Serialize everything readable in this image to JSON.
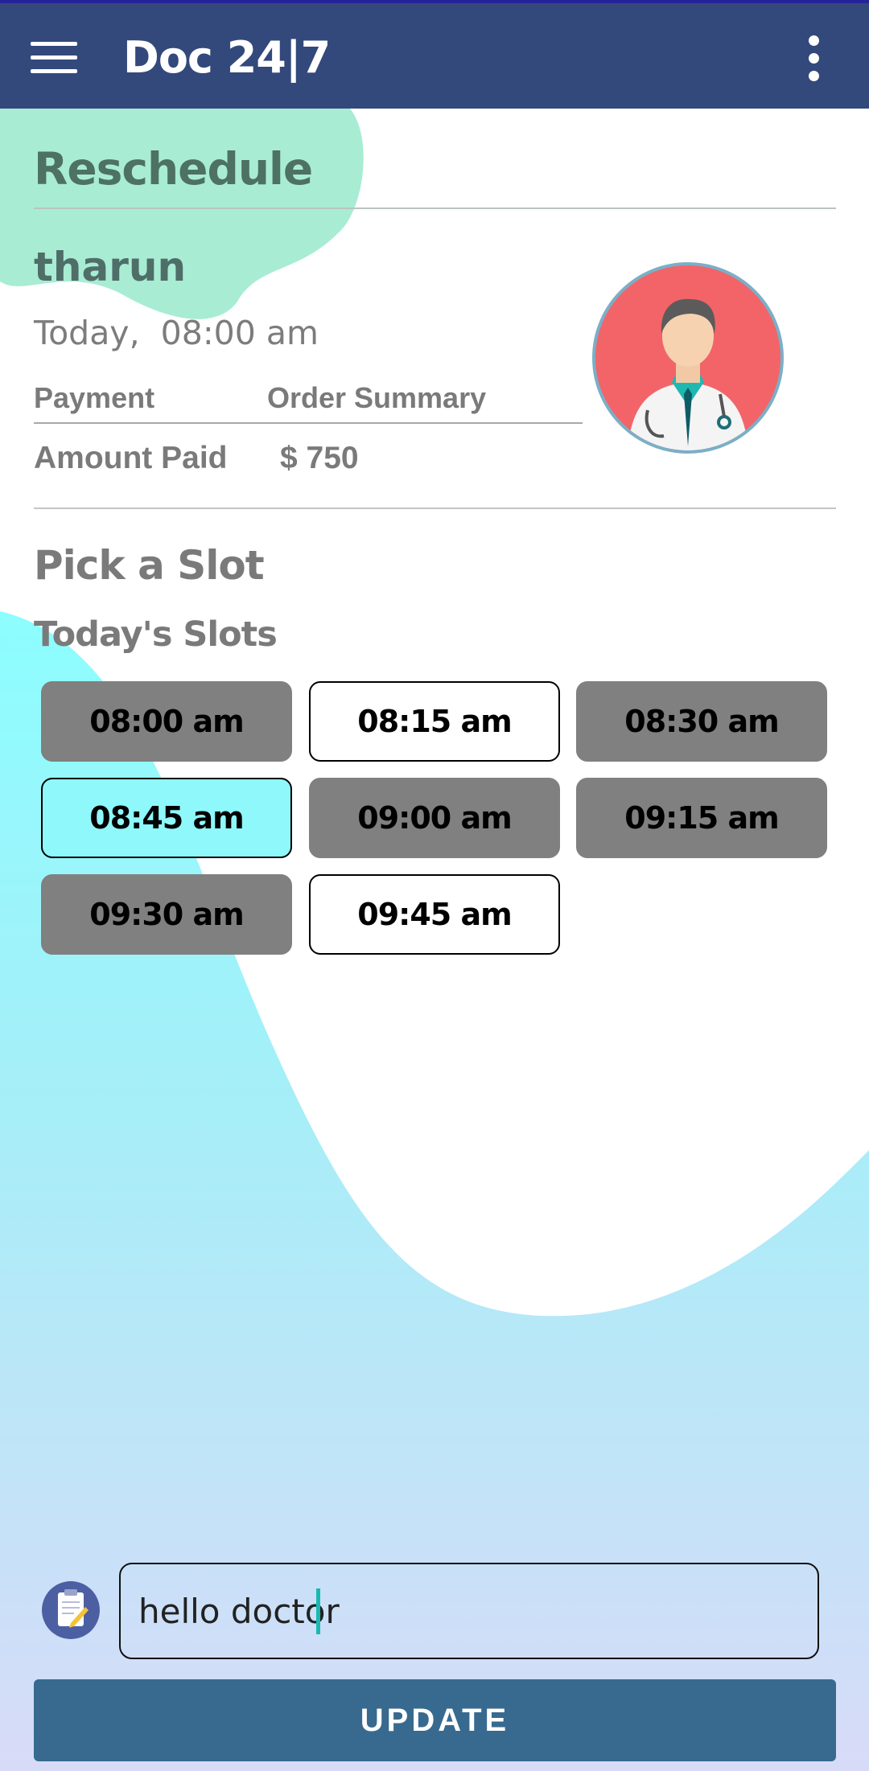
{
  "app_bar": {
    "title": "Doc 24|7",
    "menu_icon": "hamburger-menu-icon",
    "overflow_icon": "more-vert-icon",
    "color": "#33497c"
  },
  "reschedule": {
    "title": "Reschedule",
    "patient_name": "tharun",
    "appointment_time": "Today,  08:00 am",
    "payment_label": "Payment",
    "order_summary_label": "Order Summary",
    "amount_paid_label": "Amount Paid",
    "amount_paid_value": "$ 750",
    "avatar_icon": "doctor-avatar-icon"
  },
  "slots": {
    "title": "Pick a Slot",
    "subtitle": "Today's Slots",
    "items": [
      {
        "label": "08:00 am",
        "state": "unavailable"
      },
      {
        "label": "08:15 am",
        "state": "available"
      },
      {
        "label": "08:30 am",
        "state": "unavailable"
      },
      {
        "label": "08:45 am",
        "state": "selected"
      },
      {
        "label": "09:00 am",
        "state": "unavailable"
      },
      {
        "label": "09:15 am",
        "state": "unavailable"
      },
      {
        "label": "09:30 am",
        "state": "unavailable"
      },
      {
        "label": "09:45 am",
        "state": "available"
      }
    ]
  },
  "note": {
    "icon": "clipboard-notes-icon",
    "value": "hello doctor"
  },
  "update_button": {
    "label": "UPDATE",
    "color": "#386a8f"
  },
  "colors": {
    "accent_teal": "#8ef8fb",
    "heading_green": "#4d7163"
  }
}
